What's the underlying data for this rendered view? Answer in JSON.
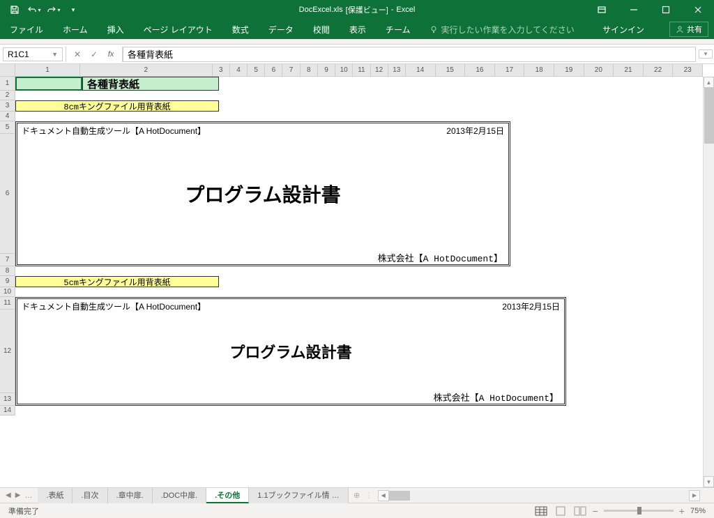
{
  "titlebar": {
    "document_name": "DocExcel.xls",
    "protected_view": "[保護ビュー]",
    "app_name": "Excel"
  },
  "ribbon": {
    "tabs": [
      "ファイル",
      "ホーム",
      "挿入",
      "ページ レイアウト",
      "数式",
      "データ",
      "校閲",
      "表示",
      "チーム"
    ],
    "tell_me": "実行したい作業を入力してください",
    "sign_in": "サインイン",
    "share": "共有"
  },
  "formula_bar": {
    "name_box": "R1C1",
    "formula": "各種背表紙"
  },
  "columns": [
    "1",
    "2",
    "3",
    "4",
    "5",
    "6",
    "7",
    "8",
    "9",
    "10",
    "11",
    "12",
    "13",
    "14",
    "15",
    "16",
    "17",
    "18",
    "19",
    "20",
    "21",
    "22",
    "23"
  ],
  "rows": [
    "1",
    "2",
    "3",
    "4",
    "5",
    "6",
    "7",
    "8",
    "9",
    "10",
    "11",
    "12",
    "13",
    "14"
  ],
  "sheet": {
    "title_main": "各種背表紙",
    "sub1": "8cmキングファイル用背表紙",
    "sub2": "5cmキングファイル用背表紙",
    "box_header_left": "ドキュメント自動生成ツール【A HotDocument】",
    "box_header_right": "2013年2月15日",
    "box_main": "プログラム設計書",
    "box_footer": "株式会社【A HotDocument】"
  },
  "tabs": {
    "nav_dots": "…",
    "items": [
      ".表紙",
      ".目次",
      ".章中扉.",
      ".DOC中扉.",
      ".その他",
      "1.1ブックファイル情"
    ]
  },
  "statusbar": {
    "ready": "準備完了",
    "zoom": "75%"
  }
}
